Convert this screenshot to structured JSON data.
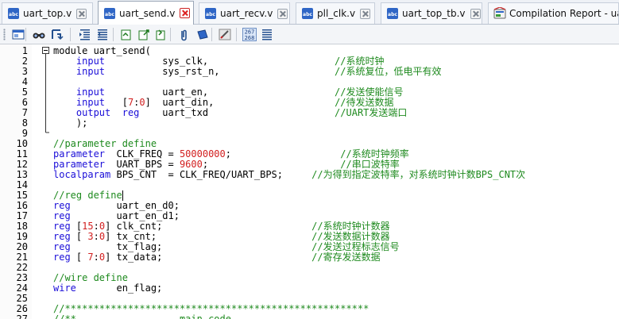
{
  "tabs": [
    {
      "label": "uart_top.v",
      "icon": "verilog-file-icon",
      "active": false
    },
    {
      "label": "uart_send.v",
      "icon": "verilog-file-icon",
      "active": true
    },
    {
      "label": "uart_recv.v",
      "icon": "verilog-file-icon",
      "active": false
    },
    {
      "label": "pll_clk.v",
      "icon": "verilog-file-icon",
      "active": false
    },
    {
      "label": "uart_top_tb.v",
      "icon": "verilog-file-icon",
      "active": false
    },
    {
      "label": "Compilation Report - uart_top",
      "icon": "compilation-report-icon",
      "active": false
    }
  ],
  "toolbar": {
    "line_number_toggle": {
      "top": "267",
      "bottom": "268"
    }
  },
  "colors": {
    "keyword": "#1a0dd8",
    "comment": "#1e8a1e",
    "number": "#d21f1f",
    "plain": "#000000"
  },
  "code": [
    {
      "n": "1",
      "fold": "start",
      "tokens": [
        {
          "t": "module uart_send(",
          "c": "pl"
        }
      ]
    },
    {
      "n": "2",
      "tokens": [
        {
          "t": "    ",
          "c": "pl"
        },
        {
          "t": "input",
          "c": "kw"
        },
        {
          "t": "          sys_clk,                      ",
          "c": "pl"
        },
        {
          "t": "//系统时钟",
          "c": "cm"
        }
      ]
    },
    {
      "n": "3",
      "tokens": [
        {
          "t": "    ",
          "c": "pl"
        },
        {
          "t": "input",
          "c": "kw"
        },
        {
          "t": "          sys_rst_n,                    ",
          "c": "pl"
        },
        {
          "t": "//系统复位，低电平有效",
          "c": "cm"
        }
      ]
    },
    {
      "n": "4",
      "tokens": []
    },
    {
      "n": "5",
      "tokens": [
        {
          "t": "    ",
          "c": "pl"
        },
        {
          "t": "input",
          "c": "kw"
        },
        {
          "t": "          uart_en,                      ",
          "c": "pl"
        },
        {
          "t": "//发送使能信号",
          "c": "cm"
        }
      ]
    },
    {
      "n": "6",
      "tokens": [
        {
          "t": "    ",
          "c": "pl"
        },
        {
          "t": "input",
          "c": "kw"
        },
        {
          "t": "   [",
          "c": "pl"
        },
        {
          "t": "7",
          "c": "num"
        },
        {
          "t": ":",
          "c": "pl"
        },
        {
          "t": "0",
          "c": "num"
        },
        {
          "t": "]  uart_din,                     ",
          "c": "pl"
        },
        {
          "t": "//待发送数据",
          "c": "cm"
        }
      ]
    },
    {
      "n": "7",
      "tokens": [
        {
          "t": "    ",
          "c": "pl"
        },
        {
          "t": "output",
          "c": "kw"
        },
        {
          "t": "  ",
          "c": "pl"
        },
        {
          "t": "reg",
          "c": "kw"
        },
        {
          "t": "    uart_txd                      ",
          "c": "pl"
        },
        {
          "t": "//UART发送端口",
          "c": "cm"
        }
      ]
    },
    {
      "n": "8",
      "tokens": [
        {
          "t": "    );",
          "c": "pl"
        }
      ]
    },
    {
      "n": "9",
      "tokens": []
    },
    {
      "n": "10",
      "tokens": [
        {
          "t": "//parameter define",
          "c": "cm"
        }
      ]
    },
    {
      "n": "11",
      "tokens": [
        {
          "t": "parameter",
          "c": "kw"
        },
        {
          "t": "  CLK_FREQ = ",
          "c": "pl"
        },
        {
          "t": "50000000",
          "c": "num"
        },
        {
          "t": ";                   ",
          "c": "pl"
        },
        {
          "t": "//系统时钟频率",
          "c": "cm"
        }
      ]
    },
    {
      "n": "12",
      "tokens": [
        {
          "t": "parameter",
          "c": "kw"
        },
        {
          "t": "  UART_BPS = ",
          "c": "pl"
        },
        {
          "t": "9600",
          "c": "num"
        },
        {
          "t": ";                       ",
          "c": "pl"
        },
        {
          "t": "//串口波特率",
          "c": "cm"
        }
      ]
    },
    {
      "n": "13",
      "tokens": [
        {
          "t": "localparam",
          "c": "kw"
        },
        {
          "t": " BPS_CNT  = CLK_FREQ/UART_BPS;     ",
          "c": "pl"
        },
        {
          "t": "//为得到指定波特率，对系统时钟计数BPS_CNT次",
          "c": "cm"
        }
      ]
    },
    {
      "n": "14",
      "tokens": []
    },
    {
      "n": "15",
      "cursor": true,
      "tokens": [
        {
          "t": "//reg define",
          "c": "cm"
        }
      ]
    },
    {
      "n": "16",
      "tokens": [
        {
          "t": "reg",
          "c": "kw"
        },
        {
          "t": "        uart_en_d0;",
          "c": "pl"
        }
      ]
    },
    {
      "n": "17",
      "tokens": [
        {
          "t": "reg",
          "c": "kw"
        },
        {
          "t": "        uart_en_d1;",
          "c": "pl"
        }
      ]
    },
    {
      "n": "18",
      "tokens": [
        {
          "t": "reg",
          "c": "kw"
        },
        {
          "t": " [",
          "c": "pl"
        },
        {
          "t": "15",
          "c": "num"
        },
        {
          "t": ":",
          "c": "pl"
        },
        {
          "t": "0",
          "c": "num"
        },
        {
          "t": "] clk_cnt;                          ",
          "c": "pl"
        },
        {
          "t": "//系统时钟计数器",
          "c": "cm"
        }
      ]
    },
    {
      "n": "19",
      "tokens": [
        {
          "t": "reg",
          "c": "kw"
        },
        {
          "t": " [ ",
          "c": "pl"
        },
        {
          "t": "3",
          "c": "num"
        },
        {
          "t": ":",
          "c": "pl"
        },
        {
          "t": "0",
          "c": "num"
        },
        {
          "t": "] tx_cnt;                           ",
          "c": "pl"
        },
        {
          "t": "//发送数据计数器",
          "c": "cm"
        }
      ]
    },
    {
      "n": "20",
      "tokens": [
        {
          "t": "reg",
          "c": "kw"
        },
        {
          "t": "        tx_flag;                          ",
          "c": "pl"
        },
        {
          "t": "//发送过程标志信号",
          "c": "cm"
        }
      ]
    },
    {
      "n": "21",
      "tokens": [
        {
          "t": "reg",
          "c": "kw"
        },
        {
          "t": " [ ",
          "c": "pl"
        },
        {
          "t": "7",
          "c": "num"
        },
        {
          "t": ":",
          "c": "pl"
        },
        {
          "t": "0",
          "c": "num"
        },
        {
          "t": "] tx_data;                          ",
          "c": "pl"
        },
        {
          "t": "//寄存发送数据",
          "c": "cm"
        }
      ]
    },
    {
      "n": "22",
      "tokens": []
    },
    {
      "n": "23",
      "tokens": [
        {
          "t": "//wire define",
          "c": "cm"
        }
      ]
    },
    {
      "n": "24",
      "tokens": [
        {
          "t": "wire",
          "c": "kw"
        },
        {
          "t": "       en_flag;",
          "c": "pl"
        }
      ]
    },
    {
      "n": "25",
      "tokens": []
    },
    {
      "n": "26",
      "tokens": [
        {
          "t": "//*****************************************************",
          "c": "cm"
        }
      ]
    },
    {
      "n": "27",
      "tokens": [
        {
          "t": "//**                  main code",
          "c": "cm"
        }
      ]
    }
  ]
}
